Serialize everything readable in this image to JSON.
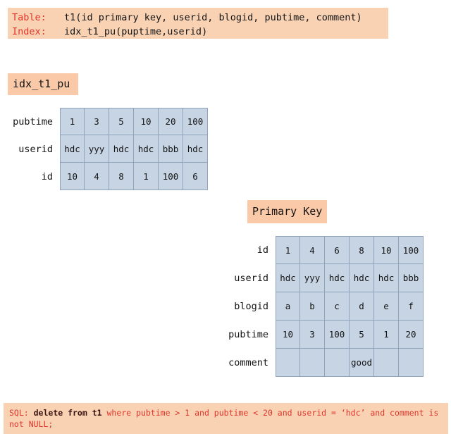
{
  "header": {
    "lines": [
      {
        "key": "Table:",
        "value": "t1(id primary key, userid, blogid, pubtime, comment)"
      },
      {
        "key": "Index:",
        "value": "idx_t1_pu(puptime,userid)"
      }
    ]
  },
  "index_section": {
    "badge_label": "idx_t1_pu",
    "rows": [
      {
        "label": "pubtime",
        "values": [
          "1",
          "3",
          "5",
          "10",
          "20",
          "100"
        ]
      },
      {
        "label": "userid",
        "values": [
          "hdc",
          "yyy",
          "hdc",
          "hdc",
          "bbb",
          "hdc"
        ]
      },
      {
        "label": "id",
        "values": [
          "10",
          "4",
          "8",
          "1",
          "100",
          "6"
        ]
      }
    ]
  },
  "primary_key_section": {
    "badge_label": "Primary Key",
    "rows": [
      {
        "label": "id",
        "values": [
          "1",
          "4",
          "6",
          "8",
          "10",
          "100"
        ]
      },
      {
        "label": "userid",
        "values": [
          "hdc",
          "yyy",
          "hdc",
          "hdc",
          "hdc",
          "bbb"
        ]
      },
      {
        "label": "blogid",
        "values": [
          "a",
          "b",
          "c",
          "d",
          "e",
          "f"
        ]
      },
      {
        "label": "pubtime",
        "values": [
          "10",
          "3",
          "100",
          "5",
          "1",
          "20"
        ]
      },
      {
        "label": "comment",
        "values": [
          "",
          "",
          "",
          "good",
          "",
          ""
        ]
      }
    ]
  },
  "sql_footer": {
    "prefix": "SQL: ",
    "emphasis": "delete from t1",
    "rest": " where pubtime > 1 and pubtime < 20 and userid =  ‘hdc’ and comment is not NULL;"
  },
  "colors": {
    "banner_bg": "#f9d2b4",
    "badge_bg": "#f9c9a8",
    "cell_bg": "#c6d4e4",
    "cell_border": "#8fa3bb",
    "accent_red": "#e0352b",
    "text_dark": "#141414",
    "page_bg": "#ffffff"
  }
}
